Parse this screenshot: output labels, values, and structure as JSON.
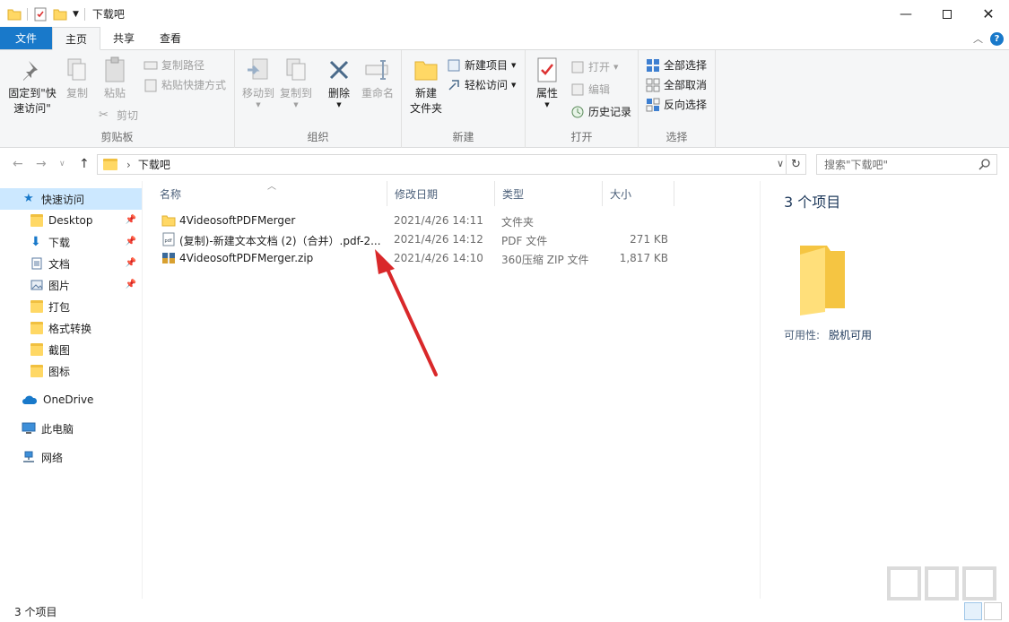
{
  "window": {
    "title": "下载吧",
    "controls": [
      "minimize",
      "maximize",
      "close"
    ]
  },
  "tabs": {
    "file": "文件",
    "home": "主页",
    "share": "共享",
    "view": "查看"
  },
  "ribbon": {
    "clipboard": {
      "label": "剪贴板",
      "pin": "固定到\"快\n速访问\"",
      "pin_line1": "固定到\"快",
      "pin_line2": "速访问\"",
      "copy": "复制",
      "paste": "粘贴",
      "copy_path": "复制路径",
      "paste_shortcut": "粘贴快捷方式",
      "cut": "剪切"
    },
    "organize": {
      "label": "组织",
      "move_to": "移动到",
      "copy_to": "复制到",
      "delete": "删除",
      "rename": "重命名"
    },
    "new": {
      "label": "新建",
      "new_folder_line1": "新建",
      "new_folder_line2": "文件夹",
      "new_item": "新建项目",
      "easy_access": "轻松访问"
    },
    "open": {
      "label": "打开",
      "properties": "属性",
      "open": "打开",
      "edit": "编辑",
      "history": "历史记录"
    },
    "select": {
      "label": "选择",
      "select_all": "全部选择",
      "select_none": "全部取消",
      "invert": "反向选择"
    }
  },
  "address": {
    "path": "下载吧",
    "search_placeholder": "搜索\"下载吧\""
  },
  "nav": {
    "quick_access": "快速访问",
    "items": [
      {
        "label": "Desktop",
        "pinned": true,
        "icon": "folder-icon"
      },
      {
        "label": "下载",
        "pinned": true,
        "icon": "download-icon"
      },
      {
        "label": "文档",
        "pinned": true,
        "icon": "document-icon"
      },
      {
        "label": "图片",
        "pinned": true,
        "icon": "pictures-icon"
      },
      {
        "label": "打包",
        "pinned": false,
        "icon": "folder-icon"
      },
      {
        "label": "格式转换",
        "pinned": false,
        "icon": "folder-icon"
      },
      {
        "label": "截图",
        "pinned": false,
        "icon": "folder-icon"
      },
      {
        "label": "图标",
        "pinned": false,
        "icon": "folder-icon"
      }
    ],
    "onedrive": "OneDrive",
    "this_pc": "此电脑",
    "network": "网络"
  },
  "columns": {
    "name": "名称",
    "modified": "修改日期",
    "type": "类型",
    "size": "大小"
  },
  "files": [
    {
      "name": "4VideosoftPDFMerger",
      "modified": "2021/4/26 14:11",
      "type": "文件夹",
      "size": "",
      "icon": "folder-icon"
    },
    {
      "name": "(复制)-新建文本文档 (2)（合并）.pdf-2...",
      "modified": "2021/4/26 14:12",
      "type": "PDF 文件",
      "size": "271 KB",
      "icon": "pdf-icon"
    },
    {
      "name": "4VideosoftPDFMerger.zip",
      "modified": "2021/4/26 14:10",
      "type": "360压缩 ZIP 文件",
      "size": "1,817 KB",
      "icon": "zip-icon"
    }
  ],
  "details": {
    "count": "3 个项目",
    "availability_label": "可用性:",
    "availability_value": "脱机可用"
  },
  "status": {
    "text": "3 个项目"
  },
  "colors": {
    "file_tab": "#1979ca",
    "selected": "#cce8ff",
    "ribbon_bg": "#f5f6f7",
    "folder": "#ffd865",
    "arrow": "#d9282a"
  }
}
